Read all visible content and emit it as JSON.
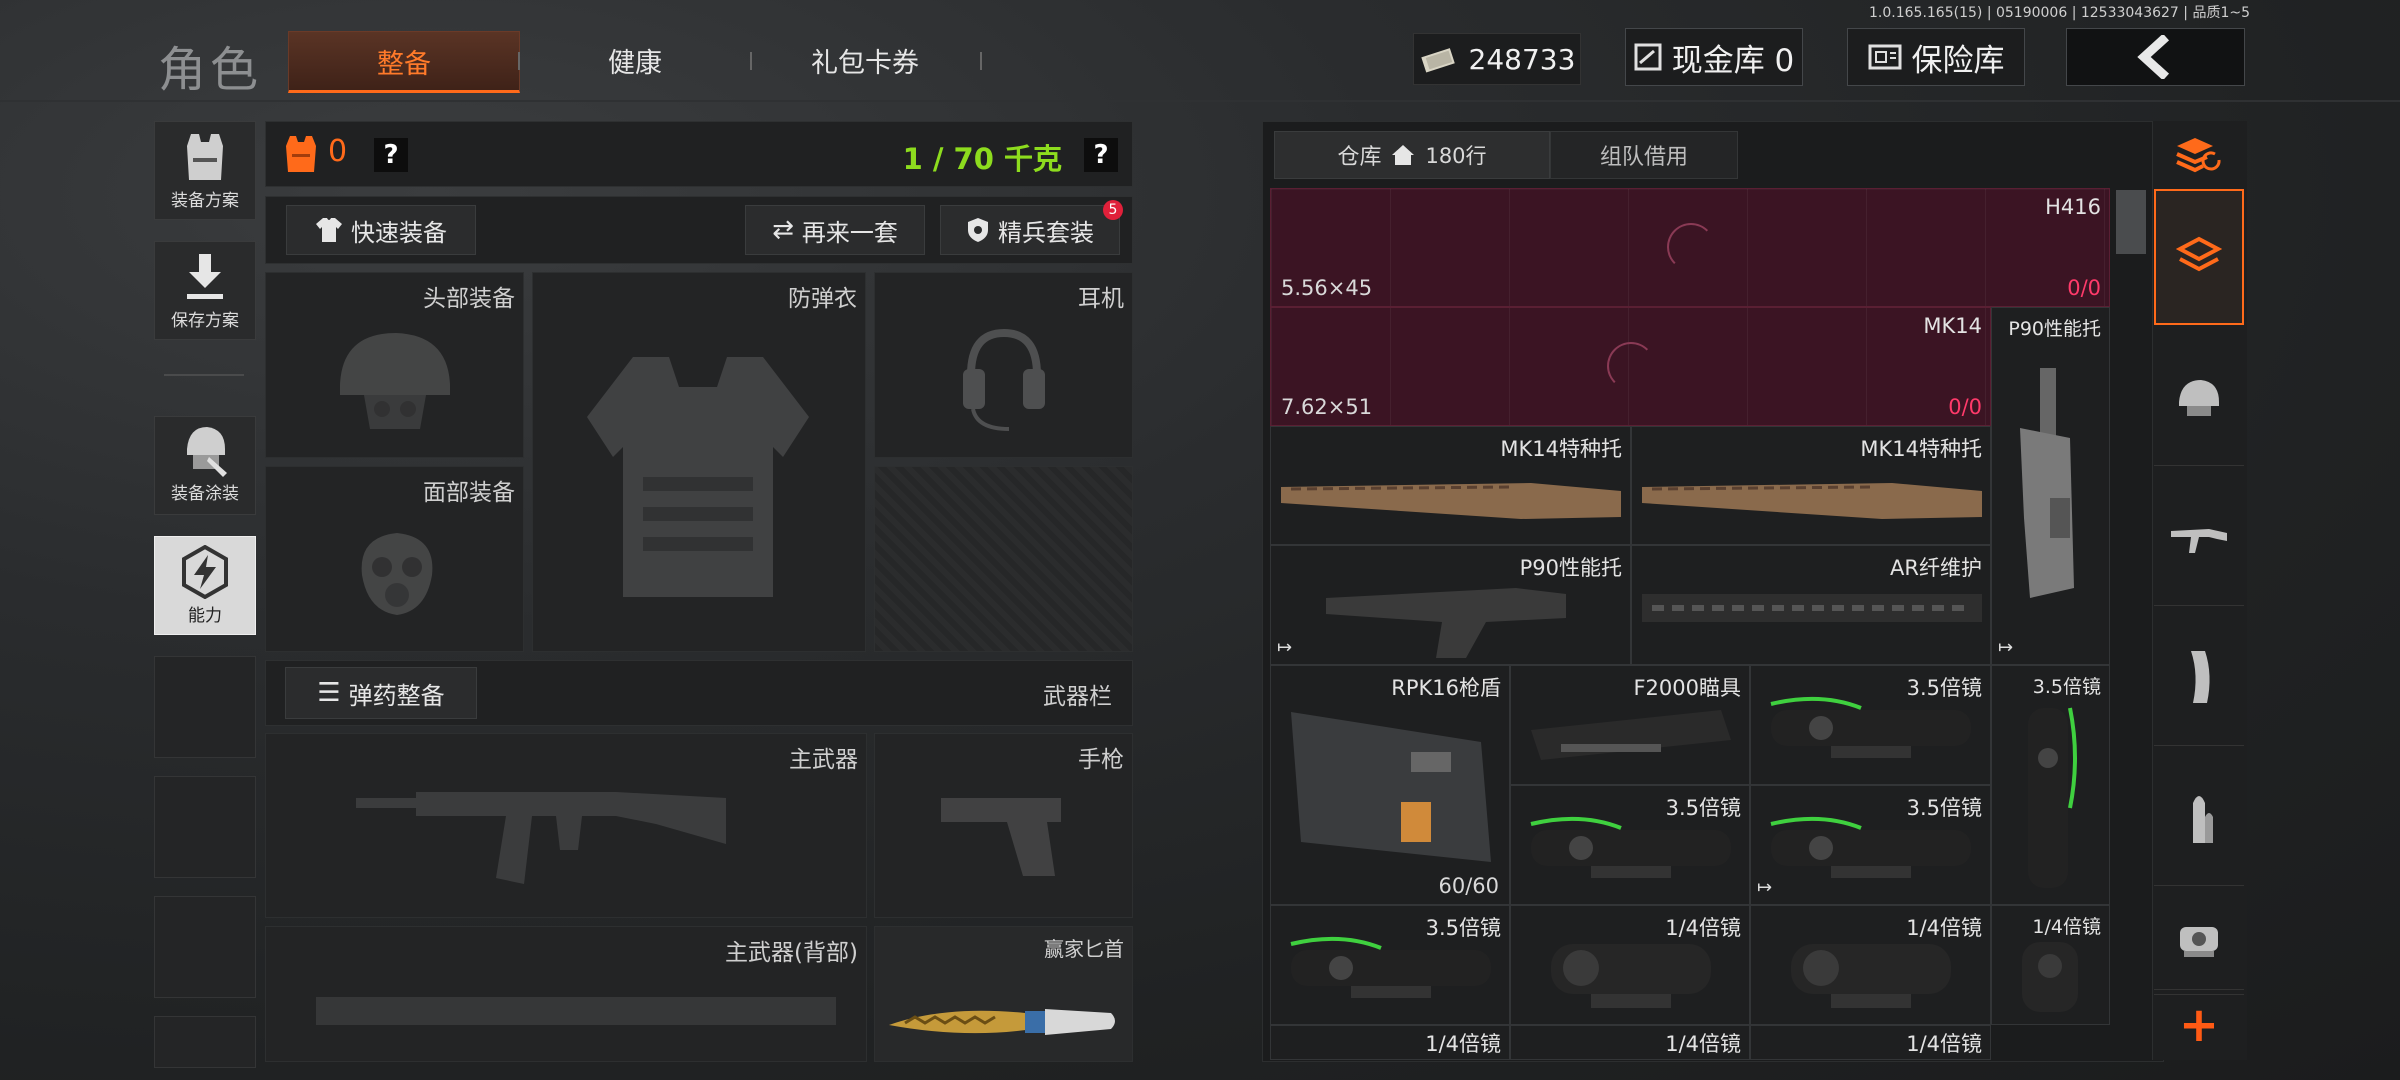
{
  "version_info": "1.0.165.165(15) | 05190006 | 12533043627 | 品质1~5",
  "header": {
    "title": "角色",
    "tabs": [
      {
        "label": "整备",
        "active": true
      },
      {
        "label": "健康",
        "active": false
      },
      {
        "label": "礼包卡券",
        "active": false
      }
    ],
    "currency_value": "248733",
    "cash_vault_label": "现金库 0",
    "insurance_label": "保险库"
  },
  "sidebar": {
    "loadout_plan": "装备方案",
    "save_plan": "保存方案",
    "skin": "装备涂装",
    "ability": "能力"
  },
  "loadout": {
    "armor_count": "0",
    "help": "?",
    "weight": "1 / 70 千克",
    "quick_equip": "快速装备",
    "again": "再来一套",
    "elite": "精兵套装",
    "elite_badge": "5",
    "slots": {
      "head": "头部装备",
      "vest": "防弹衣",
      "headset": "耳机",
      "face": "面部装备"
    },
    "ammo_equip": "弹药整备",
    "weapon_bar": "武器栏",
    "weapons": {
      "primary": "主武器",
      "pistol": "手枪",
      "primary_back": "主武器(背部)",
      "knife": "赢家匕首"
    }
  },
  "inventory": {
    "tabs": [
      {
        "label": "仓库",
        "sub": "180行",
        "active": true
      },
      {
        "label": "组队借用",
        "active": false
      }
    ],
    "items": [
      {
        "name": "H416",
        "caliber": "5.56×45",
        "ammo_a": "0",
        "ammo_b": "/0"
      },
      {
        "name": "MK14",
        "caliber": "7.62×51",
        "ammo_a": "0",
        "ammo_b": "/0"
      },
      {
        "name": "P90性能托"
      },
      {
        "name": "MK14特种托"
      },
      {
        "name": "MK14特种托"
      },
      {
        "name": "P90性能托"
      },
      {
        "name": "AR纤维护"
      },
      {
        "name": "RPK16枪盾",
        "count": "60/60"
      },
      {
        "name": "F2000瞄具"
      },
      {
        "name": "3.5倍镜"
      },
      {
        "name": "3.5倍镜"
      },
      {
        "name": "3.5倍镜"
      },
      {
        "name": "3.5倍镜"
      },
      {
        "name": "3.5倍镜"
      },
      {
        "name": "1/4倍镜"
      },
      {
        "name": "1/4倍镜"
      },
      {
        "name": "1/4倍镜"
      },
      {
        "name": "1/4倍镜"
      },
      {
        "name": "1/4倍镜"
      },
      {
        "name": "1/4倍镜"
      }
    ]
  },
  "colors": {
    "accent_orange": "#ff6a1a",
    "weight_green": "#8ddc1e",
    "rifle_bg": "#3a1220",
    "ammo_red": "#ff3a6a"
  }
}
